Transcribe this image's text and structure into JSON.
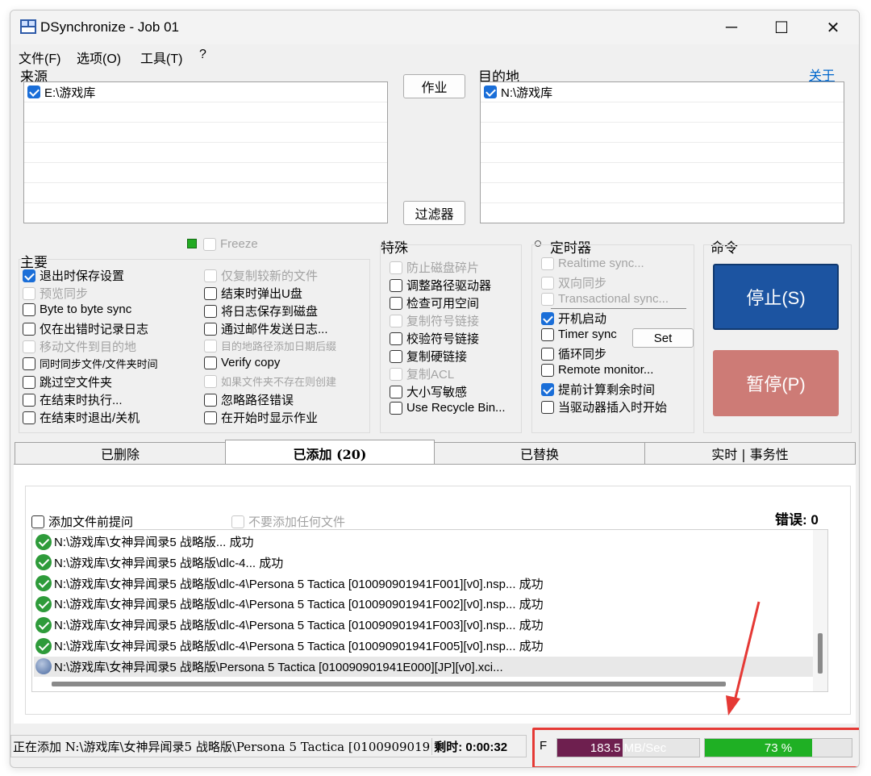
{
  "window": {
    "title": "DSynchronize - Job 01",
    "minimize": "─",
    "maximize": "☐",
    "close": "✕"
  },
  "menu": [
    "文件(F)",
    "选项(O)",
    "工具(T)",
    "?"
  ],
  "source": {
    "label": "来源",
    "items": [
      {
        "path": "E:\\游戏库",
        "checked": true
      }
    ]
  },
  "dest": {
    "label": "目的地",
    "items": [
      {
        "path": "N:\\游戏库",
        "checked": true
      }
    ]
  },
  "about_link": "关于",
  "buttons": {
    "job": "作业",
    "filter": "过滤器",
    "stop": "停止(S)",
    "pause": "暂停(P)",
    "timer_set": "Set"
  },
  "freeze": "Freeze",
  "main_options": {
    "label": "主要",
    "col1": [
      {
        "text": "退出时保存设置",
        "checked": true,
        "enabled": true
      },
      {
        "text": "预览同步",
        "checked": false,
        "enabled": false
      },
      {
        "text": "Byte to byte sync",
        "checked": false,
        "enabled": true
      },
      {
        "text": "仅在出错时记录日志",
        "checked": false,
        "enabled": true
      },
      {
        "text": "移动文件到目的地",
        "checked": false,
        "enabled": false
      },
      {
        "text": "同时同步文件/文件夹时间",
        "checked": false,
        "enabled": true
      },
      {
        "text": "跳过空文件夹",
        "checked": false,
        "enabled": true
      },
      {
        "text": "在结束时执行...",
        "checked": false,
        "enabled": true
      },
      {
        "text": "在结束时退出/关机",
        "checked": false,
        "enabled": true
      }
    ],
    "col2": [
      {
        "text": "仅复制较新的文件",
        "checked": false,
        "enabled": false
      },
      {
        "text": "结束时弹出U盘",
        "checked": false,
        "enabled": true
      },
      {
        "text": "将日志保存到磁盘",
        "checked": false,
        "enabled": true
      },
      {
        "text": "通过邮件发送日志...",
        "checked": false,
        "enabled": true
      },
      {
        "text": "目的地路径添加日期后缀",
        "checked": false,
        "enabled": false
      },
      {
        "text": "Verify copy",
        "checked": false,
        "enabled": true
      },
      {
        "text": "如果文件夹不存在则创建",
        "checked": false,
        "enabled": false
      },
      {
        "text": "忽略路径错误",
        "checked": false,
        "enabled": true
      },
      {
        "text": "在开始时显示作业",
        "checked": false,
        "enabled": true
      }
    ]
  },
  "special": {
    "label": "特殊",
    "items": [
      {
        "text": "防止磁盘碎片",
        "checked": false,
        "enabled": false
      },
      {
        "text": "调整路径驱动器",
        "checked": false,
        "enabled": true
      },
      {
        "text": "检查可用空间",
        "checked": false,
        "enabled": true
      },
      {
        "text": "复制符号链接",
        "checked": false,
        "enabled": false
      },
      {
        "text": "校验符号链接",
        "checked": false,
        "enabled": true
      },
      {
        "text": "复制硬链接",
        "checked": false,
        "enabled": true
      },
      {
        "text": "复制ACL",
        "checked": false,
        "enabled": false
      },
      {
        "text": "大小写敏感",
        "checked": false,
        "enabled": true
      },
      {
        "text": "Use Recycle Bin...",
        "checked": false,
        "enabled": true
      }
    ]
  },
  "timer": {
    "label": "定时器",
    "items": [
      {
        "text": "Realtime sync...",
        "checked": false,
        "enabled": false
      },
      {
        "text": "双向同步",
        "checked": false,
        "enabled": false
      },
      {
        "text": "Transactional sync...",
        "checked": false,
        "enabled": false
      },
      {
        "text": "开机启动",
        "checked": true,
        "enabled": true
      },
      {
        "text": "Timer sync",
        "checked": false,
        "enabled": true
      },
      {
        "text": "循环同步",
        "checked": false,
        "enabled": true
      },
      {
        "text": "Remote monitor...",
        "checked": false,
        "enabled": true
      },
      {
        "text": "提前计算剩余时间",
        "checked": true,
        "enabled": true
      },
      {
        "text": "当驱动器插入时开始",
        "checked": false,
        "enabled": true
      }
    ]
  },
  "command_label": "命令",
  "tabs": [
    "已删除",
    "已添加 (20)",
    "已替换",
    "实时 | 事务性"
  ],
  "added_panel": {
    "ask_before_add": "添加文件前提问",
    "dont_add": "不要添加任何文件",
    "errors": "错误: 0",
    "log": [
      {
        "text": "N:\\游戏库\\女神异闻录5 战略版... 成功",
        "status": "ok"
      },
      {
        "text": "N:\\游戏库\\女神异闻录5 战略版\\dlc-4... 成功",
        "status": "ok"
      },
      {
        "text": "N:\\游戏库\\女神异闻录5 战略版\\dlc-4\\Persona 5 Tactica [010090901941F001][v0].nsp... 成功",
        "status": "ok"
      },
      {
        "text": "N:\\游戏库\\女神异闻录5 战略版\\dlc-4\\Persona 5 Tactica [010090901941F002][v0].nsp... 成功",
        "status": "ok"
      },
      {
        "text": "N:\\游戏库\\女神异闻录5 战略版\\dlc-4\\Persona 5 Tactica [010090901941F003][v0].nsp... 成功",
        "status": "ok"
      },
      {
        "text": "N:\\游戏库\\女神异闻录5 战略版\\dlc-4\\Persona 5 Tactica [010090901941F005][v0].nsp... 成功",
        "status": "ok"
      },
      {
        "text": "N:\\游戏库\\女神异闻录5 战略版\\Persona 5 Tactica [010090901941E000][JP][v0].xci...",
        "status": "busy"
      }
    ]
  },
  "status": {
    "current": "正在添加 N:\\游戏库\\女神异闻录5 战略版\\Persona 5 Tactica [0100909019",
    "remaining": "剩时: 0:00:32",
    "drive_letter": "F",
    "speed": "183.5 MB/Sec",
    "speed_fraction": 0.46,
    "progress": "73 %",
    "progress_fraction": 0.73
  },
  "colors": {
    "accent": "#1c54a1",
    "pause": "#cd7b76",
    "speed_bar": "#6e1f4f",
    "progress_bar": "#1fb024",
    "highlight": "#e53935"
  }
}
